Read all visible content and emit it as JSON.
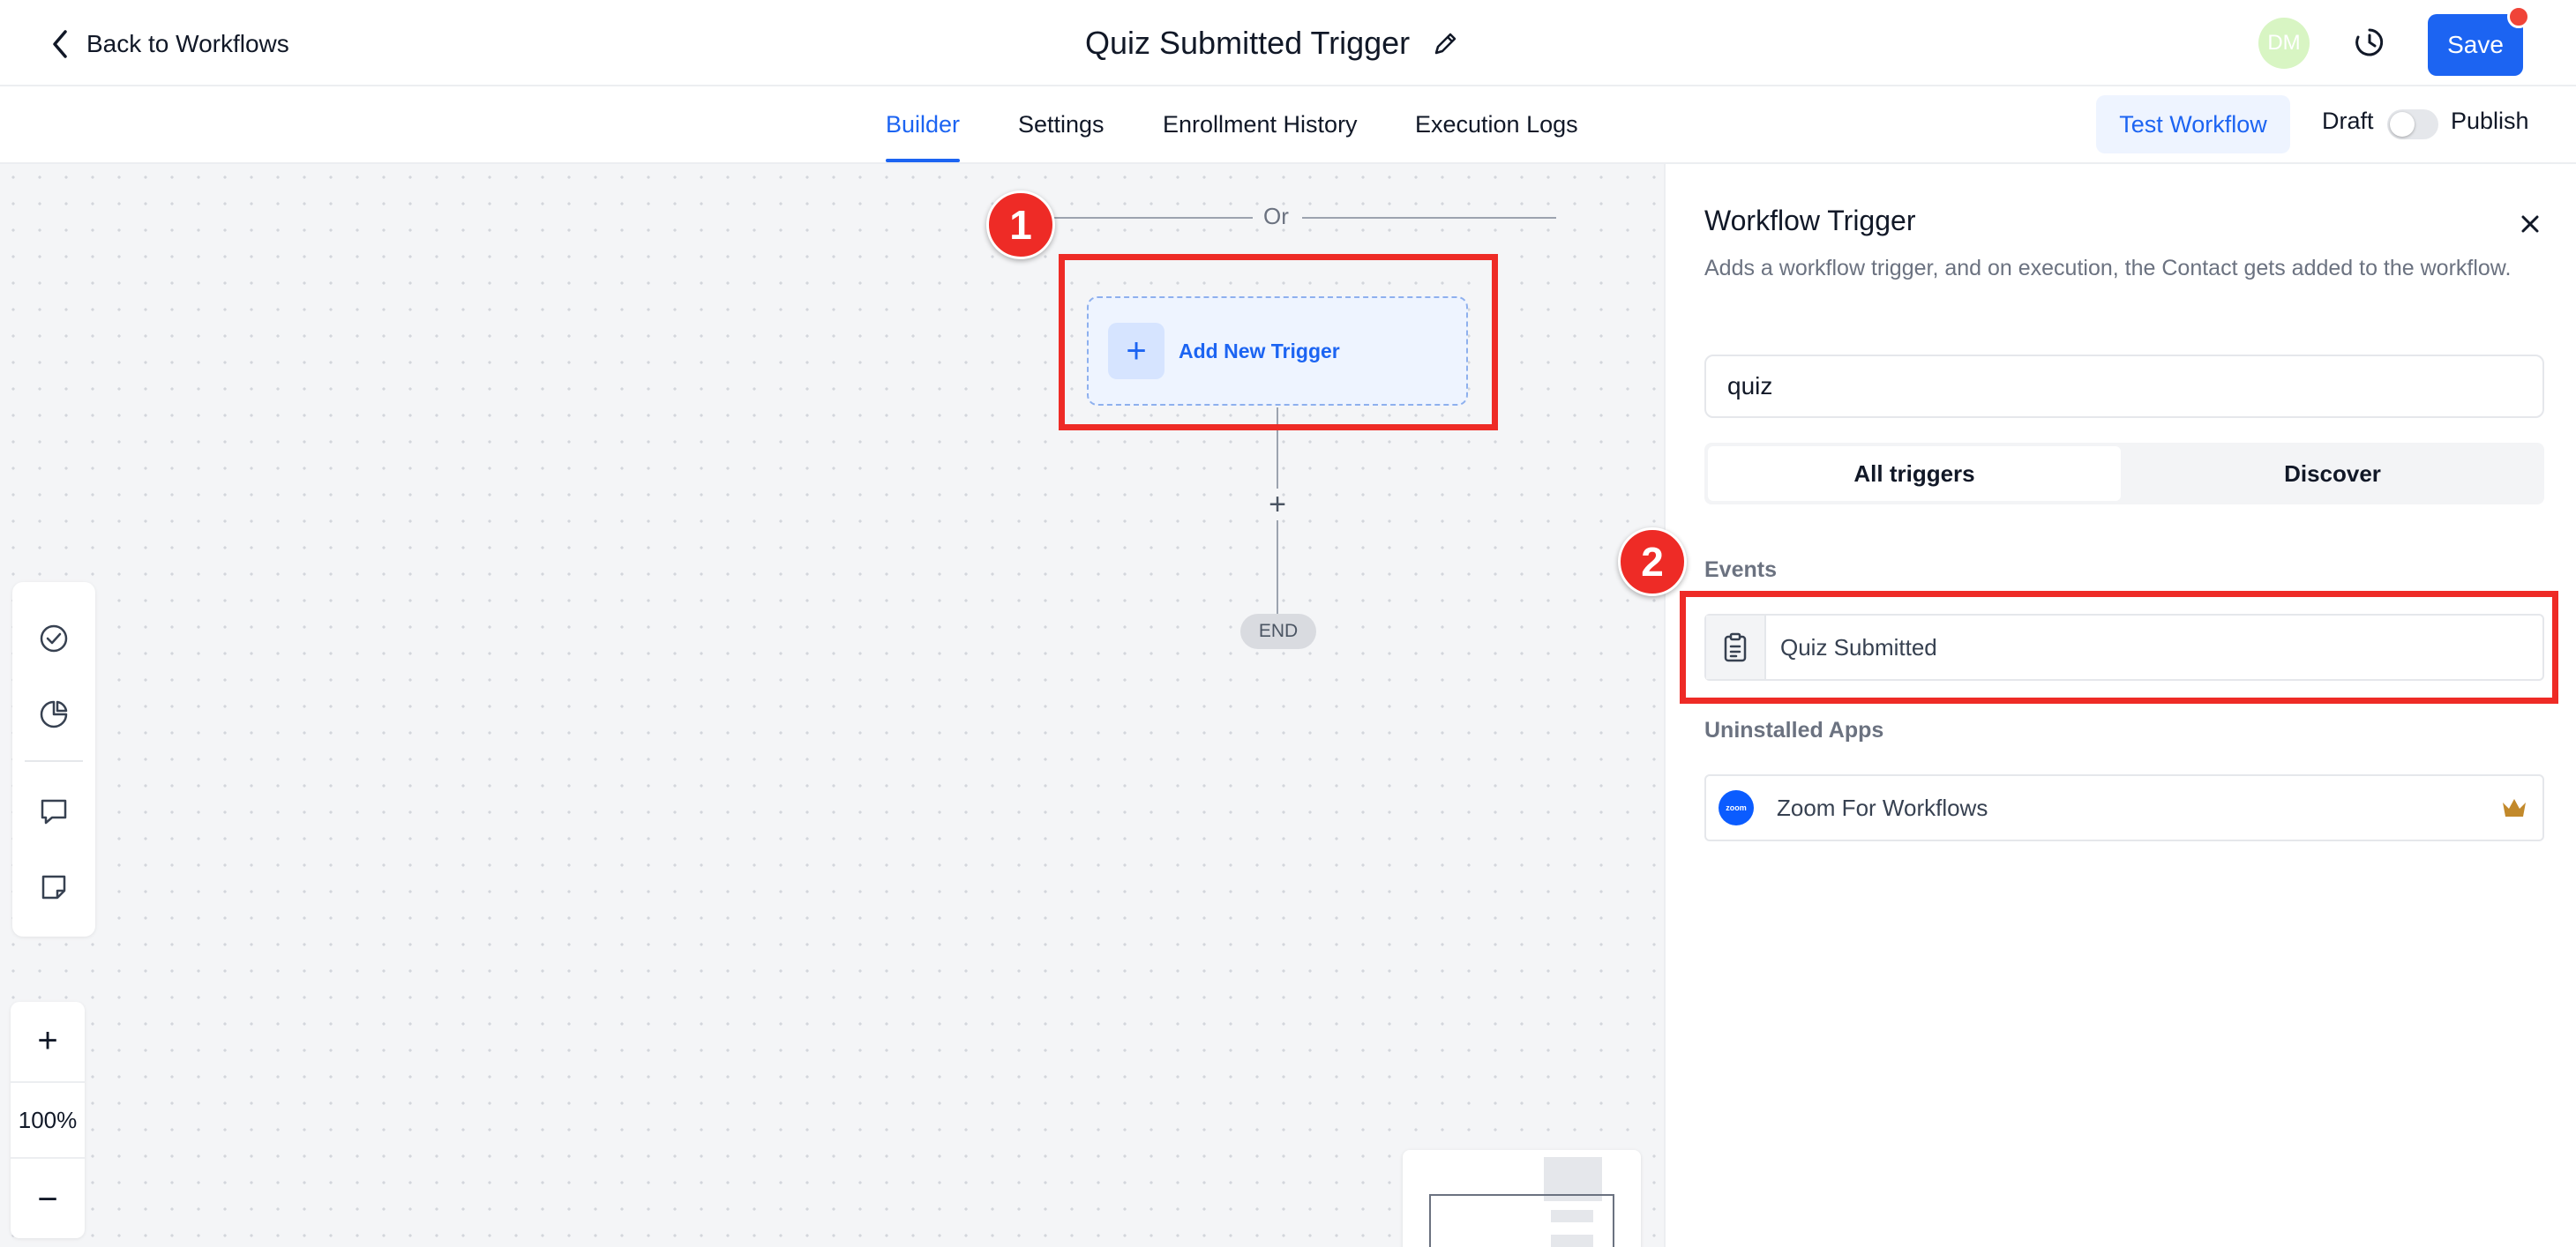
{
  "header": {
    "back_label": "Back to Workflows",
    "title": "Quiz Submitted Trigger",
    "avatar_initials": "DM",
    "save_label": "Save"
  },
  "tabs": [
    {
      "label": "Builder",
      "active": true
    },
    {
      "label": "Settings",
      "active": false
    },
    {
      "label": "Enrollment History",
      "active": false
    },
    {
      "label": "Execution Logs",
      "active": false
    }
  ],
  "toolbar": {
    "test_label": "Test Workflow",
    "draft_label": "Draft",
    "publish_label": "Publish",
    "publish_enabled": false
  },
  "canvas": {
    "or_label": "Or",
    "add_trigger_label": "Add New Trigger",
    "end_label": "END",
    "zoom_level": "100%",
    "tools": [
      "check-circle-icon",
      "pie-chart-icon",
      "comment-icon",
      "sticky-note-icon"
    ]
  },
  "annotations": [
    "1",
    "2"
  ],
  "panel": {
    "title": "Workflow Trigger",
    "description": "Adds a workflow trigger, and on execution, the Contact gets added to the workflow.",
    "search_value": "quiz",
    "segments": [
      {
        "label": "All triggers",
        "active": true
      },
      {
        "label": "Discover",
        "active": false
      }
    ],
    "events_label": "Events",
    "events": [
      {
        "label": "Quiz Submitted",
        "icon": "clipboard-icon"
      }
    ],
    "uninstalled_label": "Uninstalled Apps",
    "apps": [
      {
        "label": "Zoom For Workflows",
        "logo_text": "zoom",
        "premium": true
      }
    ]
  },
  "colors": {
    "accent": "#1c64f2",
    "annotation": "#ee2b26",
    "avatar_bg": "#d8f5c3",
    "premium": "#c2892b"
  }
}
